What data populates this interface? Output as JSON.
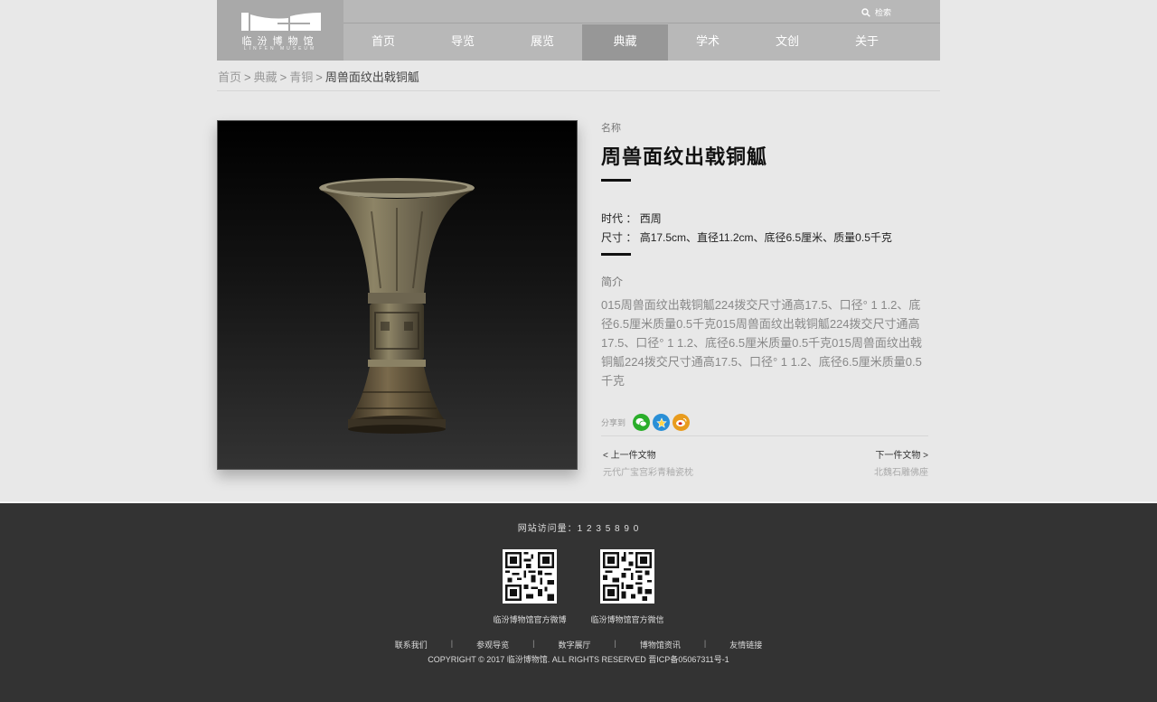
{
  "header": {
    "logo_cn": "临汾博物馆",
    "logo_en": "LINFEN MUSEUM",
    "search_label": "检索",
    "nav": [
      "首页",
      "导览",
      "展览",
      "典藏",
      "学术",
      "文创",
      "关于"
    ],
    "active_nav": 3
  },
  "breadcrumb": {
    "items": [
      "首页",
      "典藏",
      "青铜"
    ],
    "current": "周兽面纹出戟铜觚",
    "separator": ">"
  },
  "artifact": {
    "name_label": "名称",
    "title": "周兽面纹出戟铜觚",
    "era_label": "时代 ：",
    "era_value": "西周",
    "size_label": "尺寸 ：",
    "size_value": "高17.5cm、直径11.2cm、底径6.5厘米、质量0.5千克",
    "intro_label": "简介",
    "intro": "015周兽面纹出戟铜觚224拨交尺寸通高17.5、口径° 1 1.2、底径6.5厘米质量0.5千克015周兽面纹出戟铜觚224拨交尺寸通高17.5、口径° 1 1.2、底径6.5厘米质量0.5千克015周兽面纹出戟铜觚224拨交尺寸通高17.5、口径° 1 1.2、底径6.5厘米质量0.5千克"
  },
  "share": {
    "label": "分享到",
    "icons": [
      "wechat-icon",
      "qzone-icon",
      "weibo-icon"
    ],
    "colors": {
      "wechat": "#2aae2a",
      "qzone": "#2a8fd6",
      "weibo": "#e89b1d"
    }
  },
  "pager": {
    "prev_label": "< 上一件文物",
    "prev_title": "元代广宝宫彩青釉瓷枕",
    "next_label": "下一件文物 >",
    "next_title": "北魏石雕佛座"
  },
  "footer": {
    "visits": "网站访问量：1 2 3 5 8 9 0",
    "qr_weibo_label": "临汾博物馆官方微博",
    "qr_wechat_label": "临汾博物馆官方微信",
    "links": [
      "联系我们",
      "参观导览",
      "数字展厅",
      "博物馆资讯",
      "友情链接"
    ],
    "copyright": "COPYRIGHT © 2017 临汾博物馆. ALL RIGHTS RESERVED 晋ICP备05067311号-1"
  }
}
